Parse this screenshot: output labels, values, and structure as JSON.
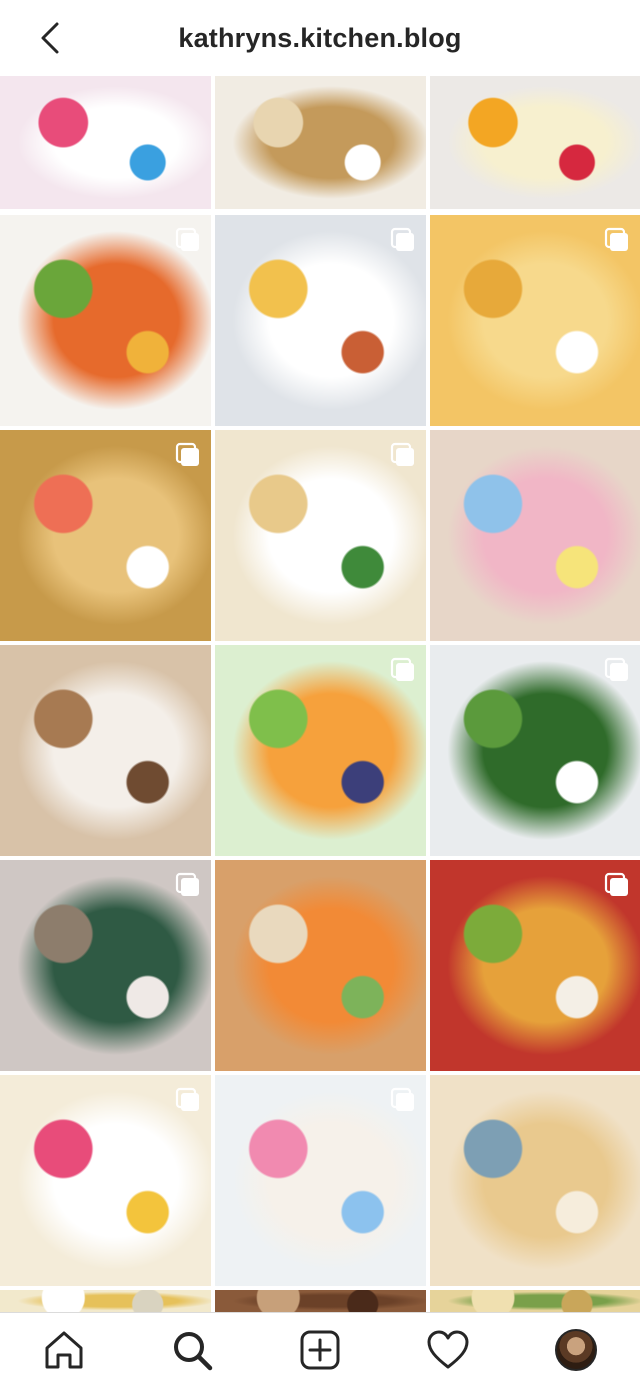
{
  "header": {
    "title": "kathryns.kitchen.blog",
    "back_icon": "chevron-left-icon"
  },
  "grid": {
    "posts": [
      {
        "name": "post-funfetti-pop-tarts",
        "multi": false,
        "colors": [
          "#f4e6ee",
          "#ffffff",
          "#e84c7a",
          "#3aa0e0"
        ]
      },
      {
        "name": "post-granola-jar",
        "multi": false,
        "colors": [
          "#f1ece3",
          "#c49a5b",
          "#e8d5b0",
          "#ffffff"
        ]
      },
      {
        "name": "post-lemon-bars",
        "multi": false,
        "colors": [
          "#ece9e6",
          "#f7f0cf",
          "#f3a623",
          "#d6283f"
        ]
      },
      {
        "name": "post-tostadas",
        "multi": true,
        "colors": [
          "#f5f3ef",
          "#e66a2c",
          "#6aa63a",
          "#f0b23a"
        ]
      },
      {
        "name": "post-deviled-eggs",
        "multi": true,
        "colors": [
          "#dfe3e8",
          "#ffffff",
          "#f2c14d",
          "#c95f35"
        ]
      },
      {
        "name": "post-mac-and-cheese",
        "multi": true,
        "colors": [
          "#f3c565",
          "#f7d98c",
          "#e7a93a",
          "#ffffff"
        ]
      },
      {
        "name": "post-savory-waffles",
        "multi": true,
        "colors": [
          "#c79a4a",
          "#e8c27a",
          "#ee6f55",
          "#ffffff"
        ]
      },
      {
        "name": "post-chips-and-dip",
        "multi": true,
        "colors": [
          "#f0e6cf",
          "#ffffff",
          "#e8c98a",
          "#3f8a3a"
        ]
      },
      {
        "name": "post-easter-chex-mix",
        "multi": false,
        "colors": [
          "#e7d6c8",
          "#f1b6c6",
          "#8fc2ea",
          "#f6e47a"
        ]
      },
      {
        "name": "post-cinnamon-roll",
        "multi": false,
        "colors": [
          "#d8c2a8",
          "#f4efe9",
          "#a77a52",
          "#6f4b31"
        ]
      },
      {
        "name": "post-fruit-salad",
        "multi": true,
        "colors": [
          "#dcefd0",
          "#f6a13c",
          "#7fbf4b",
          "#3c3f7a"
        ]
      },
      {
        "name": "post-arugula-salad",
        "multi": true,
        "colors": [
          "#e9ecee",
          "#2f6b2a",
          "#5b9a3c",
          "#ffffff"
        ]
      },
      {
        "name": "post-maternity-photo",
        "multi": true,
        "colors": [
          "#cfc7c4",
          "#2f5a44",
          "#8d7d6c",
          "#efe9e6"
        ]
      },
      {
        "name": "post-easter-bunny-platter",
        "multi": false,
        "colors": [
          "#d8a06a",
          "#f28a36",
          "#e9d9be",
          "#7db35a"
        ]
      },
      {
        "name": "post-stuffed-peppers",
        "multi": true,
        "colors": [
          "#c1362c",
          "#e6a13a",
          "#7cab3a",
          "#f4efe6"
        ]
      },
      {
        "name": "post-sprinkle-cookies",
        "multi": true,
        "colors": [
          "#f4ecd9",
          "#ffffff",
          "#e84c7a",
          "#f3c43c"
        ]
      },
      {
        "name": "post-lucky-charms-treats",
        "multi": true,
        "colors": [
          "#eef2f4",
          "#f6f1ea",
          "#f18ab0",
          "#8cc2ee"
        ]
      },
      {
        "name": "post-dinner-rolls",
        "multi": false,
        "colors": [
          "#f0e1c7",
          "#e9c98e",
          "#7d9fb4",
          "#f6eddc"
        ]
      },
      {
        "name": "post-row-7-a",
        "multi": false,
        "colors": [
          "#f2e9cc",
          "#e6c15a",
          "#ffffff",
          "#d9d3c0"
        ]
      },
      {
        "name": "post-row-7-b",
        "multi": false,
        "colors": [
          "#8a5a3a",
          "#6b4128",
          "#c7a07a",
          "#4a2a1a"
        ]
      },
      {
        "name": "post-row-7-c",
        "multi": false,
        "colors": [
          "#e6d39a",
          "#7aa04a",
          "#f0e0b0",
          "#c9a65a"
        ]
      }
    ]
  },
  "bottom_nav": {
    "items": [
      {
        "name": "nav-home",
        "icon": "home-icon"
      },
      {
        "name": "nav-search",
        "icon": "search-icon",
        "active": true
      },
      {
        "name": "nav-new-post",
        "icon": "plus-square-icon"
      },
      {
        "name": "nav-activity",
        "icon": "heart-icon"
      },
      {
        "name": "nav-profile",
        "icon": "profile-avatar"
      }
    ]
  }
}
